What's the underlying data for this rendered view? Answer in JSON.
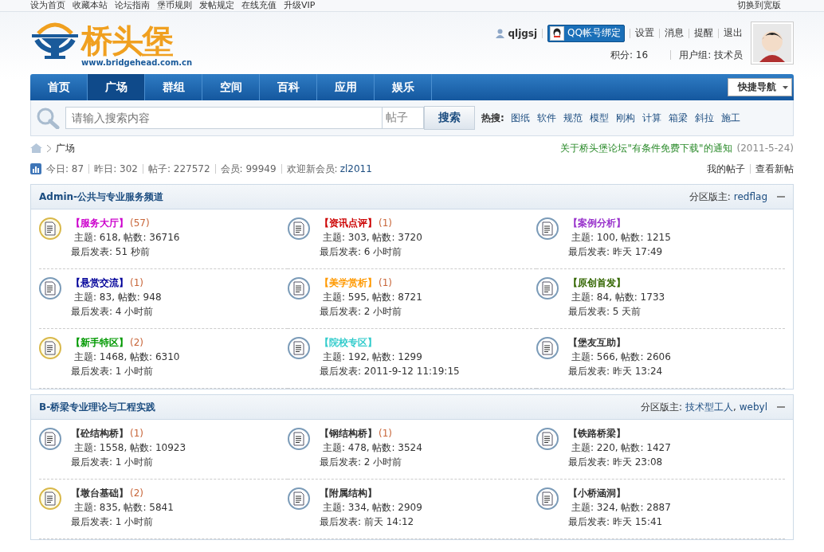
{
  "top_links": [
    "设为首页",
    "收藏本站",
    "论坛指南",
    "堡币规则",
    "发帖规定",
    "在线充值",
    "升级VIP"
  ],
  "wide_switch": "切换到宽版",
  "logo": {
    "name": "桥头堡",
    "url": "www.bridgehead.com.cn"
  },
  "user": {
    "username": "qljgsj",
    "qq_button": "QQ帐号绑定",
    "links": [
      "设置",
      "消息",
      "提醒",
      "退出"
    ],
    "points": "积分: 16",
    "group": "用户组: 技术员"
  },
  "nav": {
    "items": [
      {
        "label": "首页",
        "selected": false
      },
      {
        "label": "广场",
        "selected": true
      },
      {
        "label": "群组",
        "selected": false
      },
      {
        "label": "空间",
        "selected": false
      },
      {
        "label": "百科",
        "selected": false
      },
      {
        "label": "应用",
        "selected": false
      },
      {
        "label": "娱乐",
        "selected": false
      }
    ],
    "quick_nav": "快捷导航"
  },
  "search": {
    "placeholder": "请输入搜索内容",
    "scope": "帖子",
    "button": "搜索",
    "hot_label": "热搜:",
    "hot": [
      "图纸",
      "软件",
      "规范",
      "模型",
      "刚构",
      "计算",
      "箱梁",
      "斜拉",
      "施工"
    ]
  },
  "breadcrumb": {
    "current": "广场"
  },
  "notice": {
    "text": "关于桥头堡论坛\"有条件免费下载\"的通知",
    "date": "(2011-5-24)"
  },
  "stats": [
    "今日: 87",
    "昨日: 302",
    "帖子: 227572",
    "会员: 99949"
  ],
  "new_member": {
    "label": "欢迎新会员:",
    "name": "zl2011"
  },
  "stats_links": [
    "我的帖子",
    "查看新帖"
  ],
  "sections": [
    {
      "title": "Admin-公共与专业服务频道",
      "moderators_label": "分区版主:",
      "moderators": [
        "redflag"
      ],
      "expanded": true,
      "forums": [
        {
          "name": "【服务大厅】",
          "color": "#cc00cc",
          "count": "(57)",
          "new": true,
          "stats": "主题: 618, 帖数: 36716",
          "last": "最后发表: 51 秒前"
        },
        {
          "name": "【资讯点评】",
          "color": "#cc0000",
          "count": "(1)",
          "new": false,
          "stats": "主题: 303, 帖数: 3720",
          "last": "最后发表: 6 小时前"
        },
        {
          "name": "【案例分析】",
          "color": "#9933cc",
          "new": false,
          "stats": "主题: 100, 帖数: 1215",
          "last": "最后发表: 昨天 17:49"
        },
        {
          "name": "【悬赏交流】",
          "color": "#000099",
          "count": "(1)",
          "new": false,
          "stats": "主题: 83, 帖数: 948",
          "last": "最后发表: 4 小时前"
        },
        {
          "name": "【美学赏析】",
          "color": "#ff9900",
          "count": "(1)",
          "new": false,
          "stats": "主题: 595, 帖数: 8721",
          "last": "最后发表: 2 小时前"
        },
        {
          "name": "【原创首发】",
          "color": "#336600",
          "new": false,
          "stats": "主题: 84, 帖数: 1733",
          "last": "最后发表: 5 天前"
        },
        {
          "name": "【新手特区】",
          "color": "#009900",
          "count": "(2)",
          "new": true,
          "stats": "主题: 1468, 帖数: 6310",
          "last": "最后发表: 1 小时前"
        },
        {
          "name": "【院校专区】",
          "color": "#33cccc",
          "new": false,
          "stats": "主题: 192, 帖数: 1299",
          "last": "最后发表: 2011-9-12 11:19:15"
        },
        {
          "name": "【堡友互助】",
          "color": "#333333",
          "new": false,
          "stats": "主题: 566, 帖数: 2606",
          "last": "最后发表: 昨天 13:24"
        }
      ]
    },
    {
      "title": "B-桥梁专业理论与工程实践",
      "moderators_label": "分区版主:",
      "moderators": [
        "技术型工人",
        "webyl"
      ],
      "moderators_separator": ",",
      "expanded": true,
      "forums": [
        {
          "name": "【砼结构桥】",
          "color": "#333333",
          "count": "(1)",
          "new": false,
          "stats": "主题: 1558, 帖数: 10923",
          "last": "最后发表: 1 小时前"
        },
        {
          "name": "【钢结构桥】",
          "color": "#333333",
          "count": "(1)",
          "new": false,
          "stats": "主题: 478, 帖数: 3524",
          "last": "最后发表: 2 小时前"
        },
        {
          "name": "【铁路桥梁】",
          "color": "#333333",
          "new": false,
          "stats": "主题: 220, 帖数: 1427",
          "last": "最后发表: 昨天 23:08"
        },
        {
          "name": "【墩台基础】",
          "color": "#333333",
          "count": "(2)",
          "new": true,
          "stats": "主题: 835, 帖数: 5841",
          "last": "最后发表: 1 小时前"
        },
        {
          "name": "【附属结构】",
          "color": "#333333",
          "new": false,
          "stats": "主题: 334, 帖数: 2909",
          "last": "最后发表: 前天 14:12"
        },
        {
          "name": "【小桥涵洞】",
          "color": "#333333",
          "new": false,
          "stats": "主题: 324, 帖数: 2887",
          "last": "最后发表: 昨天 15:41"
        }
      ]
    }
  ]
}
